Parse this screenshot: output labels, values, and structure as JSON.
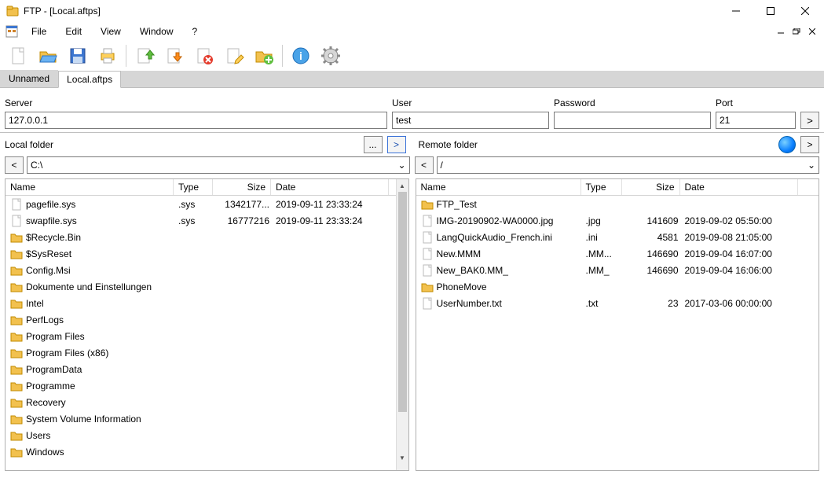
{
  "title": "FTP - [Local.aftps]",
  "menu": {
    "file": "File",
    "edit": "Edit",
    "view": "View",
    "window": "Window",
    "help": "?"
  },
  "tabs": {
    "t0": "Unnamed",
    "t1": "Local.aftps"
  },
  "conn": {
    "server_label": "Server",
    "user_label": "User",
    "password_label": "Password",
    "port_label": "Port",
    "server": "127.0.0.1",
    "user": "test",
    "password": "",
    "port": "21",
    "go": ">"
  },
  "local": {
    "label": "Local folder",
    "browse": "...",
    "go": ">",
    "up": "<",
    "path": "C:\\",
    "columns": {
      "name": "Name",
      "type": "Type",
      "size": "Size",
      "date": "Date"
    },
    "rows": [
      {
        "name": "pagefile.sys",
        "type": ".sys",
        "size": "1342177...",
        "date": "2019-09-11 23:33:24",
        "icon": "file"
      },
      {
        "name": "swapfile.sys",
        "type": ".sys",
        "size": "16777216",
        "date": "2019-09-11 23:33:24",
        "icon": "file"
      },
      {
        "name": "$Recycle.Bin",
        "type": "",
        "size": "",
        "date": "",
        "icon": "folder"
      },
      {
        "name": "$SysReset",
        "type": "",
        "size": "",
        "date": "",
        "icon": "folder"
      },
      {
        "name": "Config.Msi",
        "type": "",
        "size": "",
        "date": "",
        "icon": "folder"
      },
      {
        "name": "Dokumente und Einstellungen",
        "type": "",
        "size": "",
        "date": "",
        "icon": "folder"
      },
      {
        "name": "Intel",
        "type": "",
        "size": "",
        "date": "",
        "icon": "folder"
      },
      {
        "name": "PerfLogs",
        "type": "",
        "size": "",
        "date": "",
        "icon": "folder"
      },
      {
        "name": "Program Files",
        "type": "",
        "size": "",
        "date": "",
        "icon": "folder"
      },
      {
        "name": "Program Files (x86)",
        "type": "",
        "size": "",
        "date": "",
        "icon": "folder"
      },
      {
        "name": "ProgramData",
        "type": "",
        "size": "",
        "date": "",
        "icon": "folder"
      },
      {
        "name": "Programme",
        "type": "",
        "size": "",
        "date": "",
        "icon": "folder"
      },
      {
        "name": "Recovery",
        "type": "",
        "size": "",
        "date": "",
        "icon": "folder"
      },
      {
        "name": "System Volume Information",
        "type": "",
        "size": "",
        "date": "",
        "icon": "folder"
      },
      {
        "name": "Users",
        "type": "",
        "size": "",
        "date": "",
        "icon": "folder"
      },
      {
        "name": "Windows",
        "type": "",
        "size": "",
        "date": "",
        "icon": "folder"
      }
    ]
  },
  "remote": {
    "label": "Remote folder",
    "go": ">",
    "up": "<",
    "path": "/",
    "columns": {
      "name": "Name",
      "type": "Type",
      "size": "Size",
      "date": "Date"
    },
    "rows": [
      {
        "name": "FTP_Test",
        "type": "",
        "size": "",
        "date": "",
        "icon": "folder"
      },
      {
        "name": "IMG-20190902-WA0000.jpg",
        "type": ".jpg",
        "size": "141609",
        "date": "2019-09-02 05:50:00",
        "icon": "file"
      },
      {
        "name": "LangQuickAudio_French.ini",
        "type": ".ini",
        "size": "4581",
        "date": "2019-09-08 21:05:00",
        "icon": "file"
      },
      {
        "name": "New.MMM",
        "type": ".MM...",
        "size": "146690",
        "date": "2019-09-04 16:07:00",
        "icon": "file"
      },
      {
        "name": "New_BAK0.MM_",
        "type": ".MM_",
        "size": "146690",
        "date": "2019-09-04 16:06:00",
        "icon": "file"
      },
      {
        "name": "PhoneMove",
        "type": "",
        "size": "",
        "date": "",
        "icon": "folder"
      },
      {
        "name": "UserNumber.txt",
        "type": ".txt",
        "size": "23",
        "date": "2017-03-06 00:00:00",
        "icon": "file"
      }
    ]
  },
  "col_widths": {
    "local": {
      "name": 214,
      "type": 50,
      "size": 74,
      "date": 150
    },
    "remote": {
      "name": 210,
      "type": 52,
      "size": 74,
      "date": 150
    }
  }
}
